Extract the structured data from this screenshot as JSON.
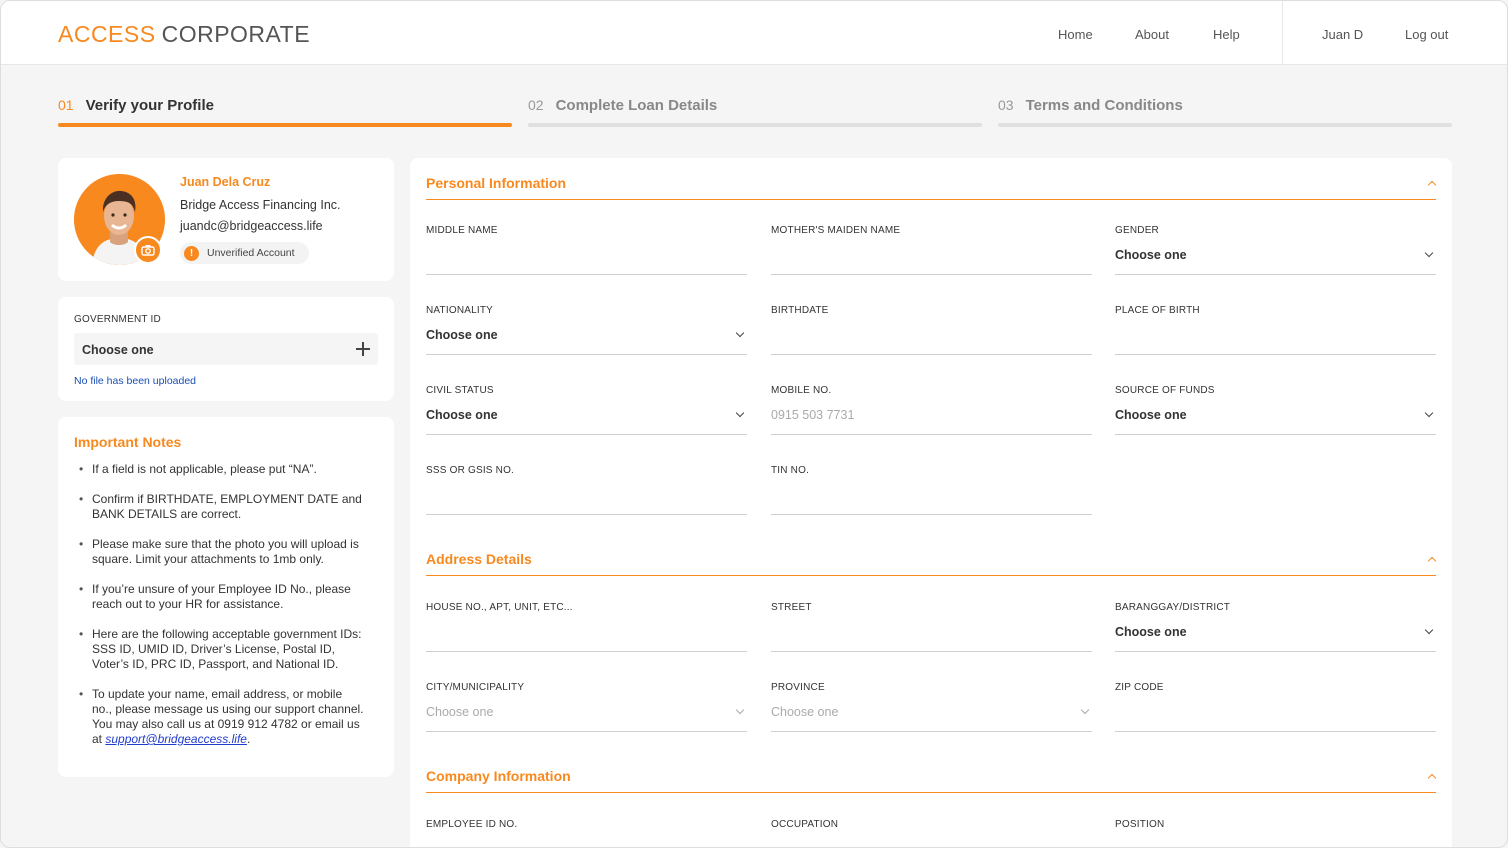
{
  "header": {
    "logo_part1": "ACCESS",
    "logo_part2": "CORPORATE",
    "nav": [
      "Home",
      "About",
      "Help"
    ],
    "user": "Juan D",
    "logout": "Log out"
  },
  "steps": [
    {
      "num": "01",
      "title": "Verify your Profile",
      "active": true
    },
    {
      "num": "02",
      "title": "Complete Loan Details",
      "active": false
    },
    {
      "num": "03",
      "title": "Terms and Conditions",
      "active": false
    }
  ],
  "profile": {
    "name": "Juan Dela Cruz",
    "company": "Bridge Access Financing Inc.",
    "email": "juandc@bridgeaccess.life",
    "status": "Unverified Account",
    "status_icon": "!"
  },
  "gov_id": {
    "label": "GOVERNMENT ID",
    "select": "Choose one",
    "note": "No file has been uploaded"
  },
  "notes": {
    "title": "Important Notes",
    "items": [
      "If a field is not applicable, please put “NA”.",
      "Confirm if BIRTHDATE, EMPLOYMENT DATE and BANK DETAILS are correct.",
      "Please make sure that the photo you will upload is square. Limit your attachments to 1mb only.",
      "If you’re unsure of your Employee ID No., please reach out to your HR for assistance.",
      "Here are the following acceptable government IDs: SSS ID, UMID ID, Driver’s License, Postal ID, Voter’s ID, PRC ID, Passport, and National ID.",
      "To update your name, email address, or mobile no., please message us using our support channel. You may also call us at 0919 912 4782 or email us at"
    ],
    "support_email": "support@bridgeaccess.life",
    "trailing": "."
  },
  "sections": {
    "personal": "Personal Information",
    "address": "Address Details",
    "company": "Company Information"
  },
  "fields": {
    "middle_name": {
      "label": "MIDDLE NAME"
    },
    "maiden_name": {
      "label": "MOTHER'S MAIDEN NAME"
    },
    "gender": {
      "label": "GENDER",
      "value": "Choose one"
    },
    "nationality": {
      "label": "NATIONALITY",
      "value": "Choose one"
    },
    "birthdate": {
      "label": "BIRTHDATE"
    },
    "place_of_birth": {
      "label": "PLACE OF BIRTH"
    },
    "civil_status": {
      "label": "CIVIL STATUS",
      "value": "Choose one"
    },
    "mobile": {
      "label": "MOBILE NO.",
      "placeholder": "0915 503 7731"
    },
    "source_of_funds": {
      "label": "SOURCE OF FUNDS",
      "value": "Choose one"
    },
    "sss_gsis": {
      "label": "SSS OR GSIS NO."
    },
    "tin": {
      "label": "TIN NO."
    },
    "house": {
      "label": "HOUSE NO., APT, UNIT, ETC..."
    },
    "street": {
      "label": "STREET"
    },
    "barangay": {
      "label": "BARANGGAY/DISTRICT",
      "value": "Choose one"
    },
    "city": {
      "label": "CITY/MUNICIPALITY",
      "placeholder": "Choose one"
    },
    "province": {
      "label": "PROVINCE",
      "placeholder": "Choose one"
    },
    "zip": {
      "label": "ZIP CODE"
    },
    "employee_id": {
      "label": "EMPLOYEE ID NO."
    },
    "occupation": {
      "label": "OCCUPATION"
    },
    "position": {
      "label": "POSITION"
    }
  },
  "colors": {
    "accent": "#f7891f",
    "link": "#1a4fb5"
  }
}
